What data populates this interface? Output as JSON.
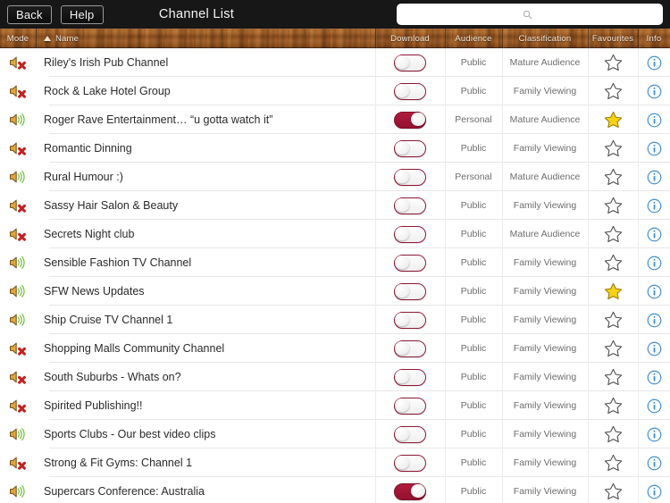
{
  "topbar": {
    "back_label": "Back",
    "help_label": "Help",
    "title": "Channel List",
    "search_value": "",
    "search_placeholder": "",
    "search_icon": "search-icon"
  },
  "columns": {
    "mode": "Mode",
    "name": "Name",
    "name_sort": "ascending",
    "download": "Download",
    "audience": "Audience",
    "classification": "Classification",
    "favourites": "Favourites",
    "info": "Info"
  },
  "colors": {
    "toggle_on": "#a5173b",
    "toggle_border": "#8e1733",
    "star_on": "#f5d117",
    "info_blue": "#3f8fd0",
    "wood": "#a0602a",
    "topbar": "#171717"
  },
  "rows": [
    {
      "mode": "muted",
      "name": "Riley's Irish Pub Channel",
      "download": false,
      "audience": "Public",
      "classification": "Mature Audience",
      "favourite": false
    },
    {
      "mode": "muted",
      "name": "Rock & Lake Hotel Group",
      "download": false,
      "audience": "Public",
      "classification": "Family Viewing",
      "favourite": false
    },
    {
      "mode": "sound",
      "name": "Roger Rave Entertainment… “u gotta watch it”",
      "download": true,
      "audience": "Personal",
      "classification": "Mature Audience",
      "favourite": true
    },
    {
      "mode": "muted",
      "name": "Romantic Dinning",
      "download": false,
      "audience": "Public",
      "classification": "Family Viewing",
      "favourite": false
    },
    {
      "mode": "sound",
      "name": "Rural Humour  :)",
      "download": false,
      "audience": "Personal",
      "classification": "Mature Audience",
      "favourite": false
    },
    {
      "mode": "muted",
      "name": "Sassy Hair Salon & Beauty",
      "download": false,
      "audience": "Public",
      "classification": "Family Viewing",
      "favourite": false
    },
    {
      "mode": "muted",
      "name": "Secrets  Night club",
      "download": false,
      "audience": "Public",
      "classification": "Mature Audience",
      "favourite": false
    },
    {
      "mode": "sound",
      "name": "Sensible Fashion TV Channel",
      "download": false,
      "audience": "Public",
      "classification": "Family Viewing",
      "favourite": false
    },
    {
      "mode": "sound",
      "name": "SFW News Updates",
      "download": false,
      "audience": "Public",
      "classification": "Family Viewing",
      "favourite": true
    },
    {
      "mode": "sound",
      "name": "Ship Cruise TV Channel 1",
      "download": false,
      "audience": "Public",
      "classification": "Family Viewing",
      "favourite": false
    },
    {
      "mode": "muted",
      "name": "Shopping Malls Community Channel",
      "download": false,
      "audience": "Public",
      "classification": "Family Viewing",
      "favourite": false
    },
    {
      "mode": "muted",
      "name": "South Suburbs - Whats on?",
      "download": false,
      "audience": "Public",
      "classification": "Family Viewing",
      "favourite": false
    },
    {
      "mode": "muted",
      "name": "Spirited Publishing!!",
      "download": false,
      "audience": "Public",
      "classification": "Family Viewing",
      "favourite": false
    },
    {
      "mode": "sound",
      "name": "Sports Clubs - Our best video clips",
      "download": false,
      "audience": "Public",
      "classification": "Family Viewing",
      "favourite": false
    },
    {
      "mode": "muted",
      "name": "Strong & Fit Gyms: Channel 1",
      "download": false,
      "audience": "Public",
      "classification": "Family Viewing",
      "favourite": false
    },
    {
      "mode": "sound",
      "name": "Supercars Conference: Australia",
      "download": true,
      "audience": "Public",
      "classification": "Family Viewing",
      "favourite": false
    }
  ]
}
